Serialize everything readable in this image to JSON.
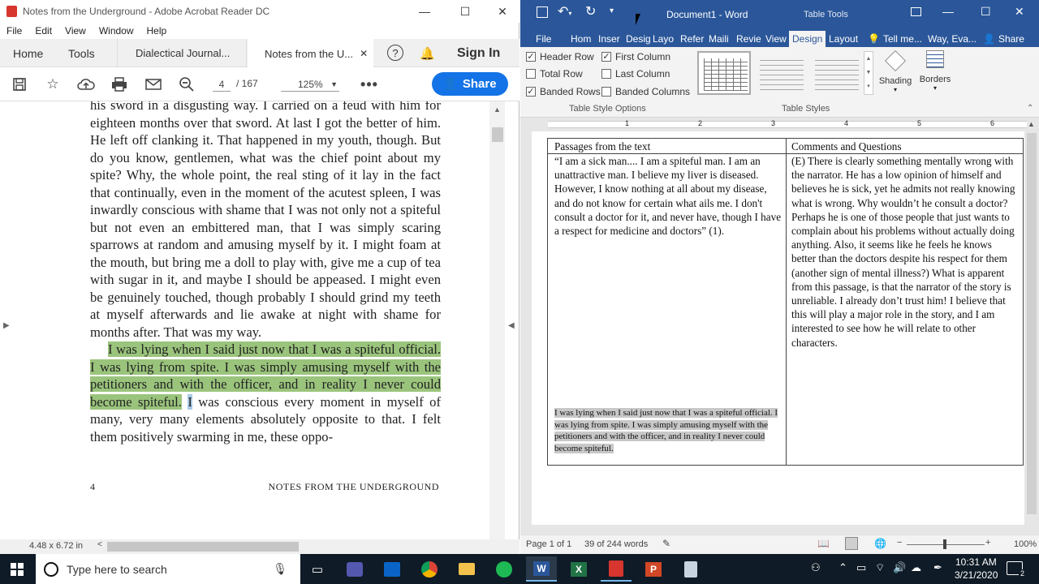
{
  "acrobat": {
    "title": "Notes from the Underground - Adobe Acrobat Reader DC",
    "menu": [
      "File",
      "Edit",
      "View",
      "Window",
      "Help"
    ],
    "tabs": {
      "home": "Home",
      "tools": "Tools",
      "tab1": "Dialectical Journal...",
      "tab2": "Notes from the U..."
    },
    "sign_in": "Sign In",
    "page_current": "4",
    "page_total": "/ 167",
    "zoom": "125%",
    "share": "Share",
    "page_size": "4.48 x 6.72 in",
    "text_before": "his sword in a disgusting way. I carried on a feud with him for eighteen months over that sword. At last I got the better of him. He left off clanking it. That happened in my youth, though. But do you know, gentlemen, what was the chief point about my spite? Why, the whole point, the real sting of it lay in the fact that continually, even in the moment of the acutest spleen, I was inwardly conscious with shame that I was not only not a spiteful but not even an embittered man, that I was simply scaring sparrows at random and amusing myself by it. I might foam at the mouth, but bring me a doll to play with, give me a cup of tea with sugar in it, and maybe I should be appeased. I might even be genuinely touched, though probably I should grind my teeth at myself afterwards and lie awake at night with shame for months after. That was my way.",
    "text_highlight": "I was lying when I said just now that I was a spiteful official. I was lying from spite. I was simply amusing myself with the petitioners and with the officer, and in reality I never could become spiteful.",
    "text_selected": "I",
    "text_after": " was conscious every moment in myself of many, very many elements absolutely opposite to that. I felt them positively swarming in me, these oppo-",
    "footer_page": "4",
    "footer_title": "NOTES FROM THE UNDERGROUND"
  },
  "word": {
    "title": "Document1 - Word",
    "context": "Table Tools",
    "tabs": [
      "File",
      "Hom",
      "Inser",
      "Desig",
      "Layo",
      "Refer",
      "Maili",
      "Revie",
      "View",
      "Design",
      "Layout"
    ],
    "tell_me": "Tell me...",
    "user": "Way, Eva...",
    "share": "Share",
    "options": {
      "header_row": "Header Row",
      "first_column": "First Column",
      "total_row": "Total Row",
      "last_column": "Last Column",
      "banded_rows": "Banded Rows",
      "banded_columns": "Banded Columns",
      "group": "Table Style Options"
    },
    "styles_group": "Table Styles",
    "shading": "Shading",
    "borders": "Borders",
    "ruler": [
      "1",
      "2",
      "3",
      "4",
      "5",
      "6"
    ],
    "table": {
      "h1": "Passages from the text",
      "h2": "Comments and Questions",
      "c1": "“I am a sick man.... I am a spiteful man. I am an unattractive man. I believe my liver is diseased. However, I know nothing at all about my disease, and do not know for certain what ails me. I don't consult a doctor for it, and never have, though I have a respect for medicine and doctors” (1).",
      "c2": "(E) There is clearly something mentally wrong with the narrator.  He has a low opinion of himself and believes he is sick, yet he admits not really knowing what is wrong.  Why wouldn’t he consult a doctor?  Perhaps he is one of those people that just wants to complain about his problems without actually doing anything.  Also, it seems like he feels he knows better than the doctors despite his respect for them (another sign of mental illness?)  What is apparent from this passage, is that the narrator of the story is unreliable.  I already don’t trust him!  I believe that this will play a major role in the story, and I am interested to see how he will relate to other characters.",
      "pasted": "I was lying when I said just now that I was a spiteful official. I was lying from spite. I was simply amusing myself with the petitioners and with the officer, and in reality I never could become spiteful."
    },
    "status": {
      "page": "Page 1 of 1",
      "words": "39 of 244 words",
      "zoom": "100%"
    }
  },
  "taskbar": {
    "search": "Type here to search",
    "time": "10:31 AM",
    "date": "3/21/2020",
    "notifications": "2"
  }
}
